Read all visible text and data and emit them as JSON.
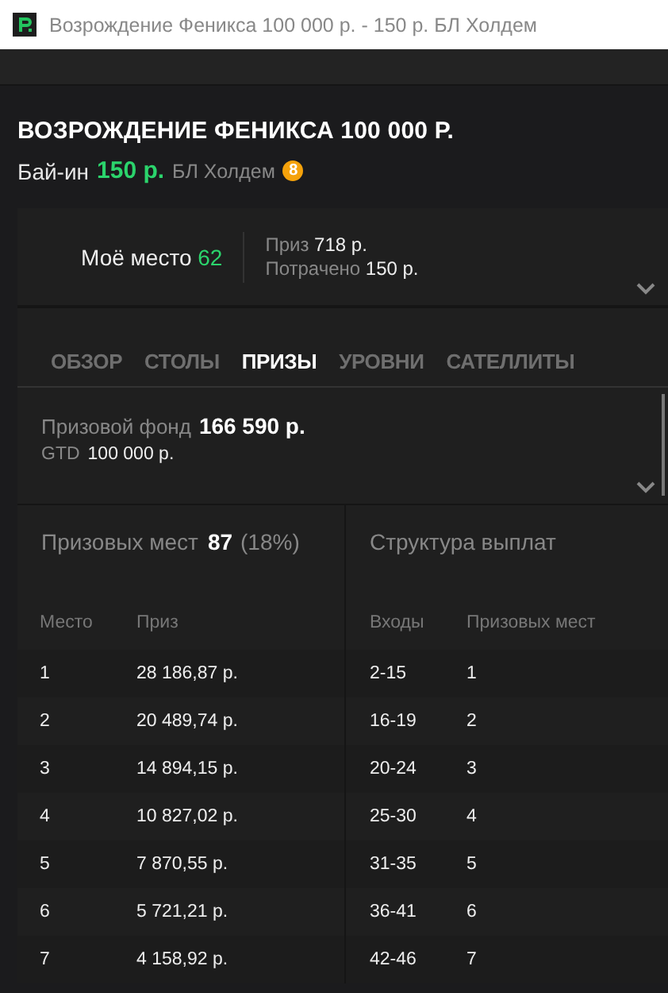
{
  "window": {
    "title": "Возрождение Феникса 100 000 р. - 150 р. БЛ Холдем"
  },
  "tournament": {
    "name": "ВОЗРОЖДЕНИЕ ФЕНИКСА 100 000 Р.",
    "buyin_label": "Бай-ин",
    "buyin": "150 р.",
    "game": "БЛ Холдем",
    "badge": "8"
  },
  "summary": {
    "place_label": "Моё место",
    "place": "62",
    "prize_label": "Приз",
    "prize": "718 р.",
    "spent_label": "Потрачено",
    "spent": "150 р."
  },
  "tabs": [
    {
      "label": "ОБЗОР",
      "selected": false
    },
    {
      "label": "СТОЛЫ",
      "selected": false
    },
    {
      "label": "ПРИЗЫ",
      "selected": true
    },
    {
      "label": "УРОВНИ",
      "selected": false
    },
    {
      "label": "САТЕЛЛИТЫ",
      "selected": false
    }
  ],
  "prize_pool": {
    "label": "Призовой фонд",
    "value": "166 590 р.",
    "gtd_label": "GTD",
    "gtd": "100 000 р."
  },
  "places": {
    "label": "Призовых мест",
    "count": "87",
    "percent": "(18%)",
    "columns": [
      "Место",
      "Приз"
    ],
    "rows": [
      [
        "1",
        "28 186,87 р."
      ],
      [
        "2",
        "20 489,74 р."
      ],
      [
        "3",
        "14 894,15 р."
      ],
      [
        "4",
        "10 827,02 р."
      ],
      [
        "5",
        "7 870,55 р."
      ],
      [
        "6",
        "5 721,21 р."
      ],
      [
        "7",
        "4 158,92 р."
      ]
    ]
  },
  "structure": {
    "label": "Структура выплат",
    "columns": [
      "Входы",
      "Призовых мест"
    ],
    "rows": [
      [
        "2-15",
        "1"
      ],
      [
        "16-19",
        "2"
      ],
      [
        "20-24",
        "3"
      ],
      [
        "25-30",
        "4"
      ],
      [
        "31-35",
        "5"
      ],
      [
        "36-41",
        "6"
      ],
      [
        "42-46",
        "7"
      ]
    ]
  }
}
